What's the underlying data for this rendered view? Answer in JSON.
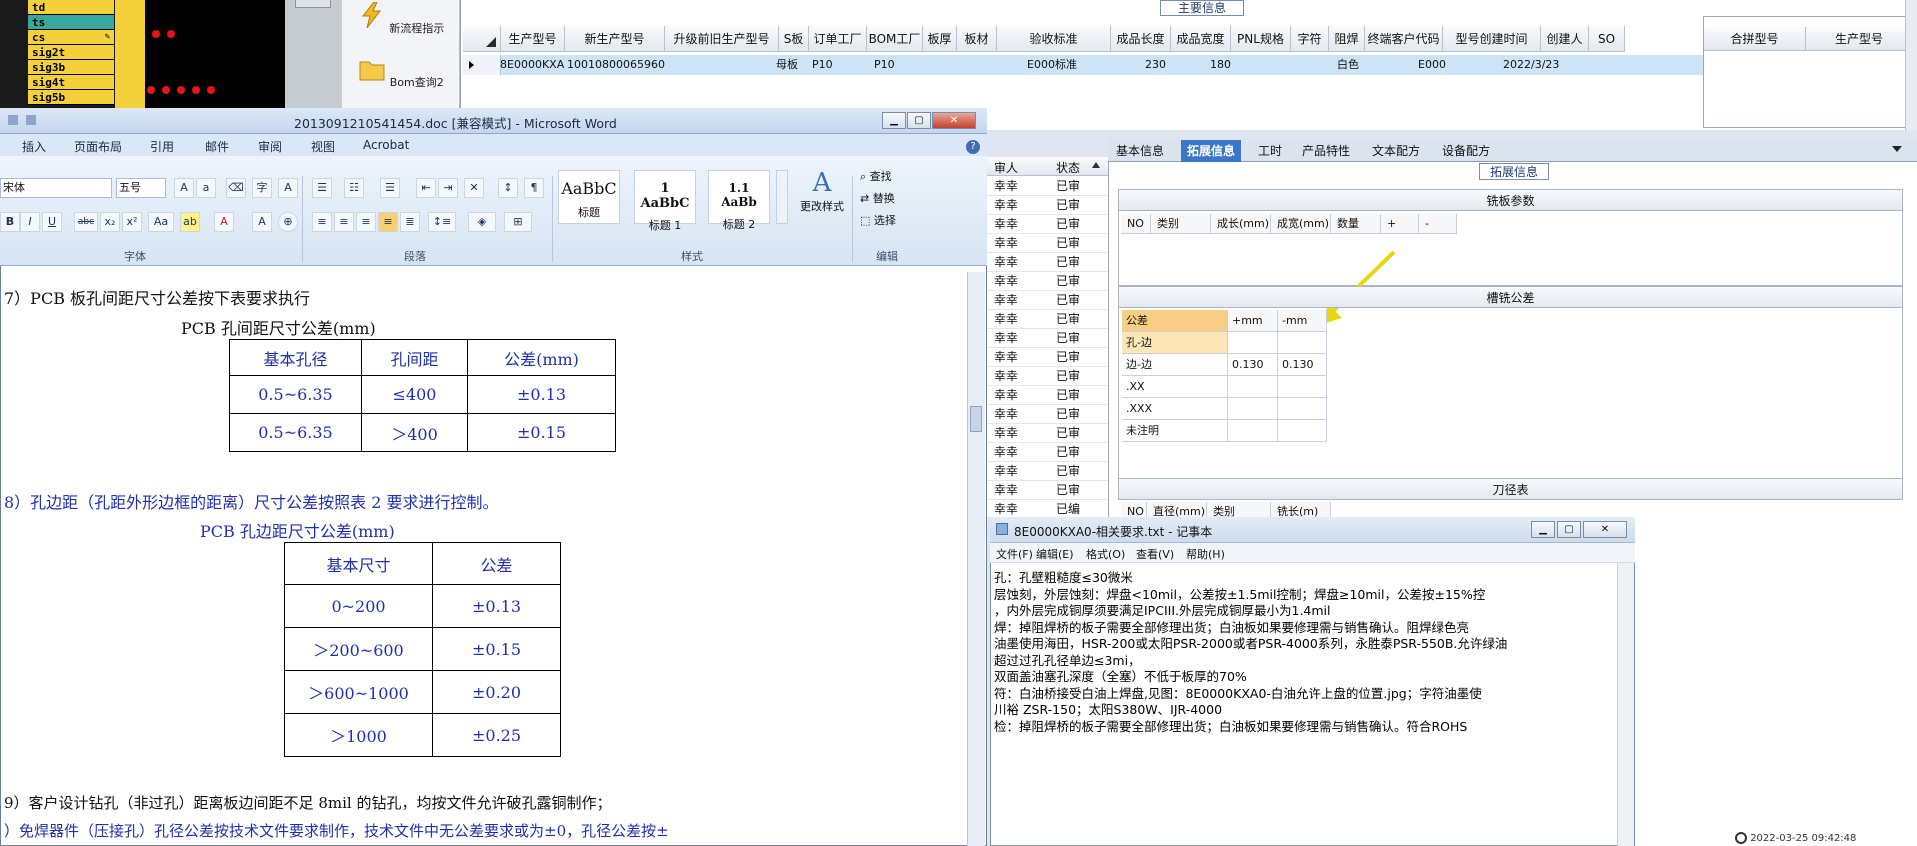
{
  "sig_list": [
    "td",
    "ts",
    "cs",
    "sig2t",
    "sig3b",
    "sig4t",
    "sig5b"
  ],
  "toolbar": {
    "new_flow": "新流程指示",
    "bom_query": "Bom查询2"
  },
  "main_grid": {
    "title": "主要信息",
    "columns": [
      "生产型号",
      "新生产型号",
      "升级前旧生产型号",
      "S板",
      "订单工厂",
      "BOM工厂",
      "板厚",
      "板材",
      "验收标准",
      "成品长度",
      "成品宽度",
      "PNL规格",
      "字符",
      "阻焊",
      "终端客户代码",
      "型号创建时间",
      "创建人",
      "SO"
    ],
    "row": {
      "prod_model": "8E0000KXA0",
      "new_prod_model": "10010800065960",
      "s_board": "母板",
      "order_factory": "P10",
      "bom_factory": "P10",
      "acceptance": "E000标准",
      "length": "230",
      "width": "180",
      "char_color": "白色",
      "end_customer": "E000",
      "created": "2022/3/23"
    },
    "merge_columns": [
      "合拼型号",
      "生产型号"
    ]
  },
  "right_tabs": [
    "基本信息",
    "拓展信息",
    "工时",
    "产品特性",
    "文本配方",
    "设备配方"
  ],
  "right_active_tab": "拓展信息",
  "ext": {
    "group_title": "拓展信息",
    "milling_title": "铣板参数",
    "milling_cols": [
      "NO",
      "类别",
      "成长(mm)",
      "成宽(mm)",
      "数量",
      "+",
      "-"
    ],
    "slot_title": "槽铣公差",
    "tol_header": [
      "公差",
      "+mm",
      "-mm"
    ],
    "tol_rows": [
      {
        "name": "孔-边",
        "plus": "",
        "minus": ""
      },
      {
        "name": "边-边",
        "plus": "0.130",
        "minus": "0.130"
      },
      {
        "name": ".XX",
        "plus": "",
        "minus": ""
      },
      {
        "name": ".XXX",
        "plus": "",
        "minus": ""
      },
      {
        "name": "未注明",
        "plus": "",
        "minus": ""
      }
    ],
    "tool_title": "刀径表",
    "tool_cols": [
      "NO",
      "直径(mm)",
      "类别",
      "铣长(m)"
    ]
  },
  "review_col": {
    "headers": [
      "审人",
      "状态"
    ],
    "name": "幸幸",
    "status": "已审",
    "last_status": "已编"
  },
  "word": {
    "title": "2013091210541454.doc [兼容模式] - Microsoft Word",
    "tabs": [
      "插入",
      "页面布局",
      "引用",
      "邮件",
      "审阅",
      "视图",
      "Acrobat"
    ],
    "font": "宋体",
    "size": "五号",
    "styles": [
      {
        "preview": "AaBbC",
        "label": "标题"
      },
      {
        "preview": "1 AaBbC",
        "label": "标题 1"
      },
      {
        "preview": "1.1 AaBb",
        "label": "标题 2"
      }
    ],
    "change_style": "更改样式",
    "edit_find": "查找",
    "edit_replace": "替换",
    "edit_select": "选择",
    "groups": [
      "字体",
      "段落",
      "样式",
      "编辑"
    ],
    "line7": "7）PCB 板孔间距尺寸公差按下表要求执行",
    "table1_title": "PCB 孔间距尺寸公差(mm)",
    "table1_head": [
      "基本孔径",
      "孔间距",
      "公差(mm)"
    ],
    "table1_rows": [
      [
        "0.5~6.35",
        "≤400",
        "±0.13"
      ],
      [
        "0.5~6.35",
        "＞400",
        "±0.15"
      ]
    ],
    "line8": "8）孔边距（孔距外形边框的距离）尺寸公差按照表 2 要求进行控制。",
    "table2_title": "PCB 孔边距尺寸公差(mm)",
    "table2_head": [
      "基本尺寸",
      "公差"
    ],
    "table2_rows": [
      [
        "0~200",
        "±0.13"
      ],
      [
        "＞200~600",
        "±0.15"
      ],
      [
        "＞600~1000",
        "±0.20"
      ],
      [
        "＞1000",
        "±0.25"
      ]
    ],
    "line9": "9）客户设计钻孔（非过孔）距离板边间距不足 8mil 的钻孔，均按文件允许破孔露铜制作；",
    "line10": "）免焊器件（压接孔）孔径公差按技术文件要求制作，技术文件中无公差要求或为±0，孔径公差按±"
  },
  "notepad": {
    "title": "8E0000KXA0-相关要求.txt - 记事本",
    "menu": [
      "文件(F)",
      "编辑(E)",
      "格式(O)",
      "查看(V)",
      "帮助(H)"
    ],
    "lines": [
      "孔：孔壁粗糙度≤30微米",
      "层蚀刻，外层蚀刻：焊盘<10mil，公差按±1.5mil控制；焊盘≥10mil，公差按±15%控",
      "，内外层完成铜厚须要满足IPCIII.外层完成铜厚最小为1.4mil",
      "焊：掉阻焊桥的板子需要全部修理出货；白油板如果要修理需与销售确认。阻焊绿色亮",
      "油墨使用海田，HSR-200或太阳PSR-2000或者PSR-4000系列，永胜泰PSR-550B.允许绿油",
      "超过过孔孔径单边≤3mi，",
      "       双面盖油塞孔深度（全塞）不低于板厚的70%",
      "符：白油桥接受白油上焊盘,见图：8E0000KXA0-白油允许上盘的位置.jpg；字符油墨使",
      "川裕 ZSR-150；太阳S380W、IJR-4000",
      "检：掉阻焊桥的板子需要全部修理出货；白油板如果要修理需与销售确认。符合ROHS"
    ]
  },
  "clock": "2022-03-25 09:42:48"
}
